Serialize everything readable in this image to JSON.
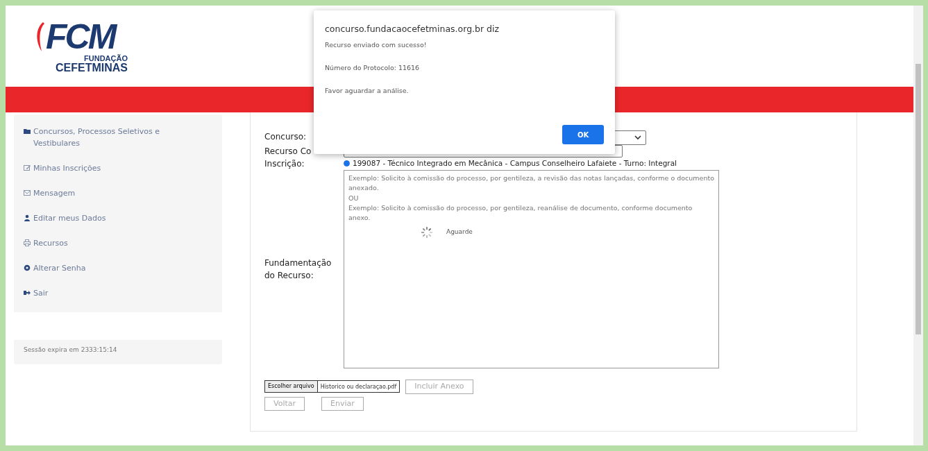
{
  "header": {
    "logo": {
      "mark": "FCM",
      "line_1": "FUNDAÇÃO",
      "line_2": "CEFETMINAS"
    }
  },
  "sidebar": {
    "items": [
      {
        "label": "Concursos, Processos Seletivos e Vestibulares",
        "kind": "folder"
      },
      {
        "label": "Minhas Inscrições",
        "kind": "edit"
      },
      {
        "label": "Mensagem",
        "kind": "envelope"
      },
      {
        "label": "Editar meus Dados",
        "kind": "user"
      },
      {
        "label": "Recursos",
        "kind": "printer"
      },
      {
        "label": "Alterar Senha",
        "kind": "gear"
      },
      {
        "label": "Sair",
        "kind": "exit"
      }
    ],
    "session": "Sessão expira em 2333:15:14"
  },
  "form": {
    "concurso_label": "Concurso:",
    "recurso_label": "Recurso Co",
    "inscricao_label": "Inscrição:",
    "inscricao": {
      "label": "199087 - Técnico Integrado em Mecânica - Campus Conselheiro Lafaiete - Turno: Integral",
      "selected": true
    },
    "fundamentacao_label": "Fundamentação do Recurso:",
    "fundamentacao": {
      "placeholder": "Exemplo: Solicito à comissão do processo, por gentileza, a revisão das notas lançadas, conforme o documento anexado.\nOU\nExemplo: Solicito à comissão do processo, por gentileza, reanálise de documento, conforme documento anexo."
    },
    "loading": "Aguarde",
    "file": {
      "button": "Escolher arquivo",
      "filename": "Historico ou declaraçao.pdf"
    },
    "buttons": [
      {
        "label": "Incluir Anexo",
        "disabled": true,
        "kind": "attach"
      },
      {
        "label": "Voltar",
        "disabled": true,
        "kind": "nav"
      },
      {
        "label": "Enviar",
        "disabled": true,
        "kind": "nav"
      }
    ]
  },
  "dialog": {
    "title": "concurso.fundacaocefetminas.org.br diz",
    "lines": [
      "Recurso enviado com sucesso!",
      "Número do Protocolo: 11616",
      "Favor aguardar a análise."
    ],
    "ok": "OK"
  }
}
